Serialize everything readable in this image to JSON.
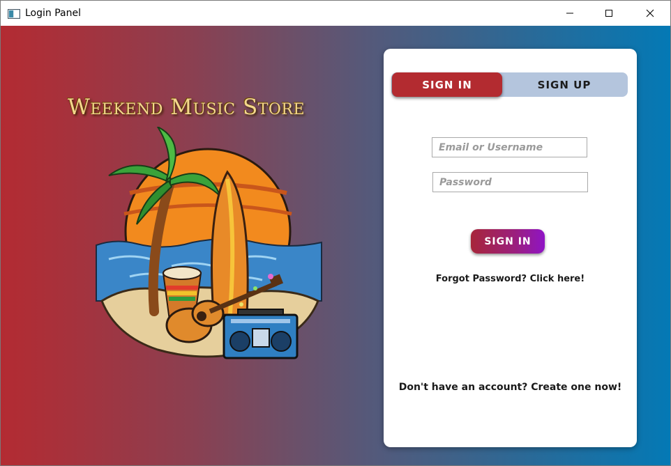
{
  "window": {
    "title": "Login Panel",
    "icon": "app-window-icon",
    "controls": [
      "minimize-icon",
      "maximize-icon",
      "close-icon"
    ]
  },
  "branding": {
    "logo_text": "Weekend Music Store",
    "illustration": "beach-music-illustration"
  },
  "login": {
    "tabs": [
      {
        "label": "SIGN IN",
        "active": true
      },
      {
        "label": "SIGN UP",
        "active": false
      }
    ],
    "email_placeholder": "Email or Username",
    "email_value": "",
    "password_placeholder": "Password",
    "password_value": "",
    "submit_label": "SIGN IN",
    "forgot_text": "Forgot Password? Click here!",
    "create_text": "Don't have an account? Create one now!"
  },
  "colors": {
    "gradient_left": "#b32b32",
    "gradient_right": "#0479b5",
    "tab_active": "#b32b30",
    "tab_track": "#b4c5dd",
    "button_start": "#a7263a",
    "button_end": "#8f14c5"
  }
}
